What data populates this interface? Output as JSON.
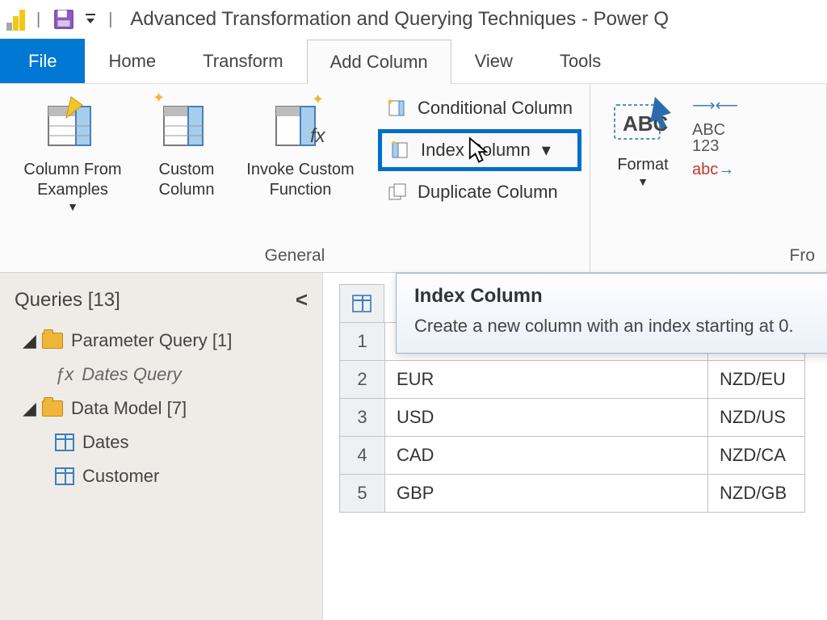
{
  "titlebar": {
    "title": "Advanced Transformation and Querying Techniques - Power Q"
  },
  "tabs": {
    "file": "File",
    "home": "Home",
    "transform": "Transform",
    "add_column": "Add Column",
    "view": "View",
    "tools": "Tools"
  },
  "ribbon": {
    "group_general_label": "General",
    "group_from_label": "Fro",
    "column_from_examples": "Column From\nExamples",
    "custom_column": "Custom\nColumn",
    "invoke_custom_function": "Invoke Custom\nFunction",
    "conditional_column": "Conditional Column",
    "index_column": "Index Column",
    "duplicate_column": "Duplicate Column",
    "format": "Format",
    "extra_abc123": "ABC\n123",
    "extra_abc_arrow": "abc"
  },
  "tooltip": {
    "title": "Index Column",
    "body": "Create a new column with an index starting at 0."
  },
  "queries": {
    "header": "Queries [13]",
    "groups": [
      {
        "label": "Parameter Query [1]",
        "children": [
          {
            "kind": "fx",
            "label": "Dates Query"
          }
        ]
      },
      {
        "label": "Data Model [7]",
        "children": [
          {
            "kind": "table",
            "label": "Dates"
          },
          {
            "kind": "table",
            "label": "Customer"
          }
        ]
      }
    ]
  },
  "grid": {
    "rows": [
      {
        "n": "1",
        "c1": "",
        "c2": ""
      },
      {
        "n": "2",
        "c1": "EUR",
        "c2": "NZD/EU"
      },
      {
        "n": "3",
        "c1": "USD",
        "c2": "NZD/US"
      },
      {
        "n": "4",
        "c1": "CAD",
        "c2": "NZD/CA"
      },
      {
        "n": "5",
        "c1": "GBP",
        "c2": "NZD/GB"
      }
    ]
  }
}
